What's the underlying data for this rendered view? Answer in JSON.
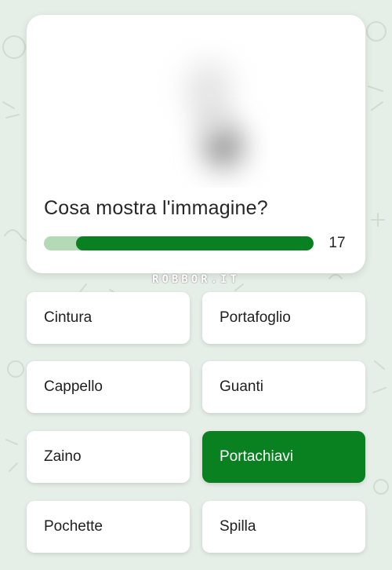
{
  "question": {
    "text": "Cosa mostra l'immagine?",
    "timer_seconds": "17",
    "timer_remaining_fraction": 0.88
  },
  "watermark": "ROBBOR.IT",
  "answers": [
    {
      "label": "Cintura",
      "selected": false
    },
    {
      "label": "Portafoglio",
      "selected": false
    },
    {
      "label": "Cappello",
      "selected": false
    },
    {
      "label": "Guanti",
      "selected": false
    },
    {
      "label": "Zaino",
      "selected": false
    },
    {
      "label": "Portachiavi",
      "selected": true
    },
    {
      "label": "Pochette",
      "selected": false
    },
    {
      "label": "Spilla",
      "selected": false
    }
  ],
  "colors": {
    "background": "#e6efe7",
    "accent": "#0a8120",
    "progress_track": "#b4d9b7"
  }
}
